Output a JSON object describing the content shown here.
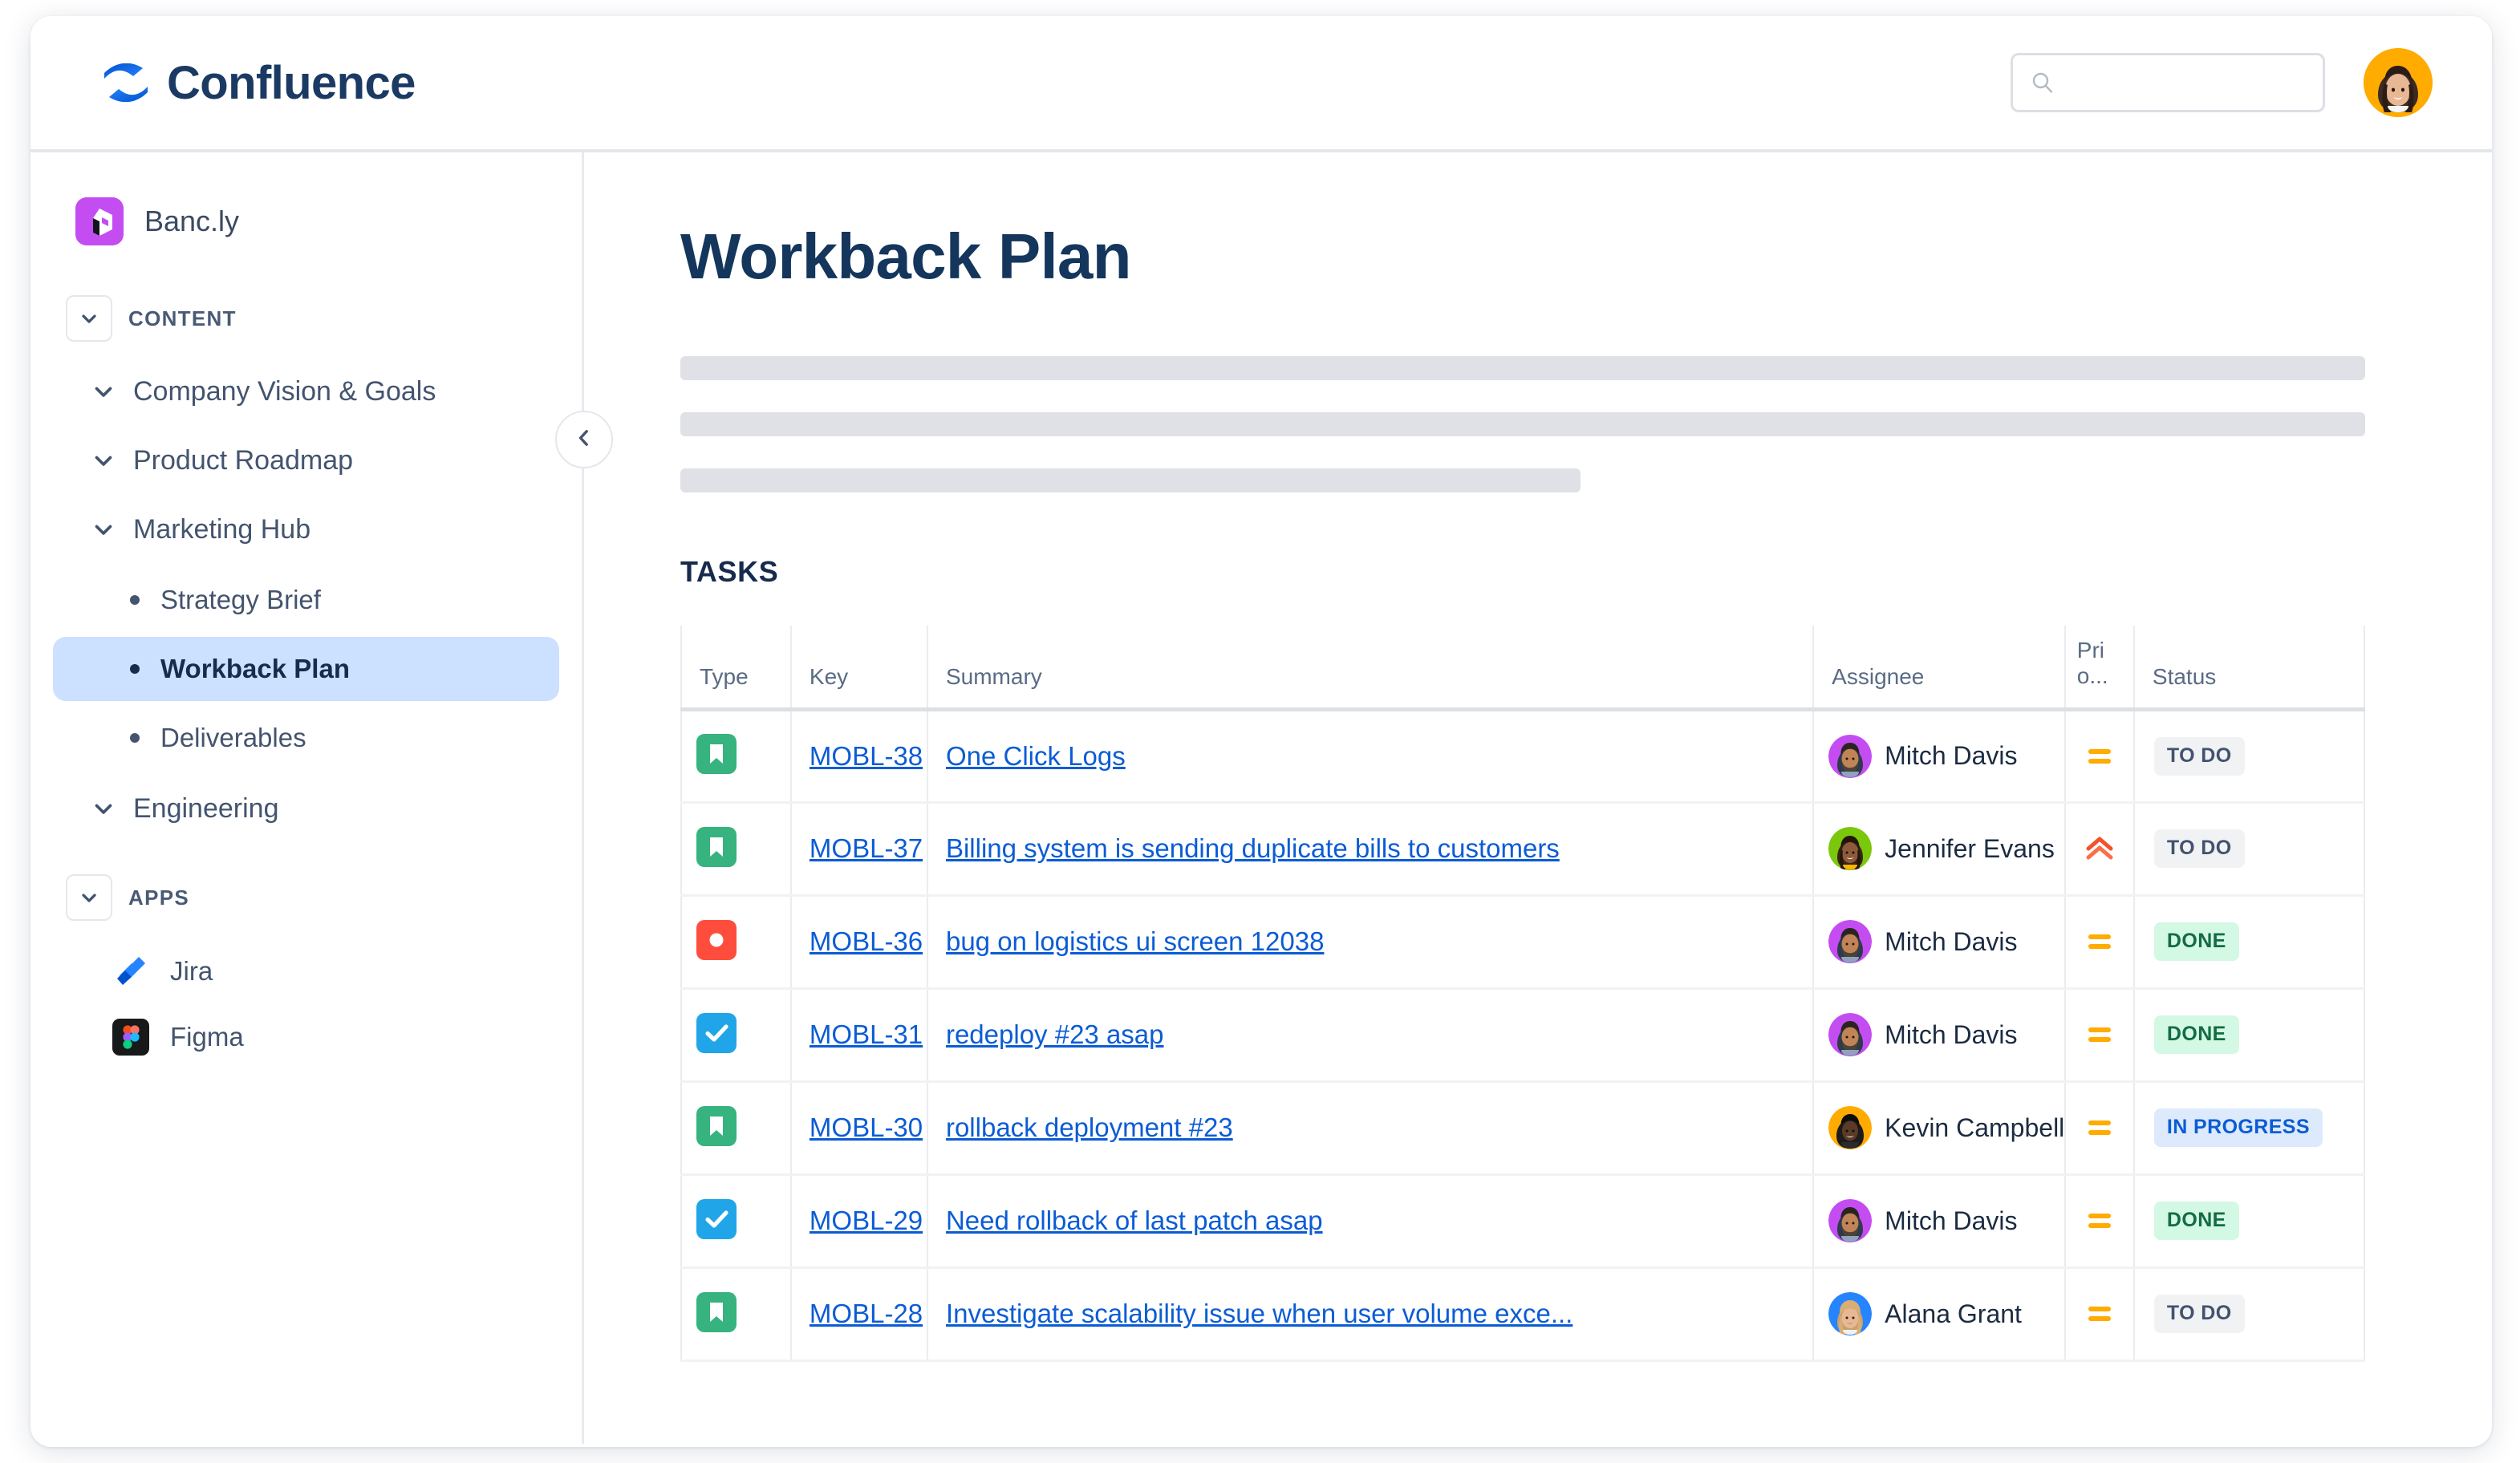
{
  "app": {
    "name": "Confluence",
    "logo_icon": "confluence-logo-icon"
  },
  "topbar": {
    "search": {
      "placeholder": "",
      "value": "",
      "icon": "search-icon"
    },
    "user_avatar": {
      "icon": "user-avatar",
      "background": "#ffab00"
    }
  },
  "sidebar": {
    "space": {
      "name": "Banc.ly",
      "logo_icon": "bancly-logo-icon",
      "logo_color": "#c44df2"
    },
    "collapse_button": {
      "icon": "chevron-left-icon"
    },
    "sections": [
      {
        "label": "CONTENT",
        "chevron_icon": "chevron-down-icon",
        "items": [
          {
            "label": "Company Vision & Goals",
            "chevron_icon": "chevron-down-icon",
            "children": []
          },
          {
            "label": "Product Roadmap",
            "chevron_icon": "chevron-down-icon",
            "children": []
          },
          {
            "label": "Marketing Hub",
            "chevron_icon": "chevron-down-icon",
            "children": [
              {
                "label": "Strategy Brief",
                "selected": false
              },
              {
                "label": "Workback Plan",
                "selected": true
              },
              {
                "label": "Deliverables",
                "selected": false
              }
            ]
          },
          {
            "label": "Engineering",
            "chevron_icon": "chevron-down-icon",
            "children": []
          }
        ]
      },
      {
        "label": "APPS",
        "chevron_icon": "chevron-down-icon",
        "apps": [
          {
            "label": "Jira",
            "icon": "jira-icon"
          },
          {
            "label": "Figma",
            "icon": "figma-icon"
          }
        ]
      }
    ]
  },
  "main": {
    "page_title": "Workback Plan",
    "skeleton_bars": [
      100,
      100,
      53
    ],
    "tasks_heading": "TASKS",
    "table": {
      "columns": [
        {
          "key": "type",
          "label": "Type"
        },
        {
          "key": "key",
          "label": "Key"
        },
        {
          "key": "summary",
          "label": "Summary"
        },
        {
          "key": "assignee",
          "label": "Assignee"
        },
        {
          "key": "priority",
          "label_line1": "Pri",
          "label_line2": "o..."
        },
        {
          "key": "status",
          "label": "Status"
        }
      ],
      "rows": [
        {
          "type": "story",
          "type_icon": "story-icon",
          "type_color": "#36b37e",
          "key": "MOBL-38",
          "summary": "One Click Logs",
          "assignee": "Mitch Davis",
          "assignee_color": "#c44df2",
          "priority": "medium",
          "priority_icon": "priority-medium-icon",
          "status": "TO DO",
          "status_style": "todo"
        },
        {
          "type": "story",
          "type_icon": "story-icon",
          "type_color": "#36b37e",
          "key": "MOBL-37",
          "summary": "Billing system is sending duplicate bills to customers",
          "assignee": "Jennifer Evans",
          "assignee_color": "#7ac70c",
          "priority": "high",
          "priority_icon": "priority-high-icon",
          "status": "TO DO",
          "status_style": "todo"
        },
        {
          "type": "bug",
          "type_icon": "bug-icon",
          "type_color": "#ff4d3d",
          "key": "MOBL-36",
          "summary": "bug on logistics ui screen 12038",
          "assignee": "Mitch Davis",
          "assignee_color": "#c44df2",
          "priority": "medium",
          "priority_icon": "priority-medium-icon",
          "status": "DONE",
          "status_style": "done"
        },
        {
          "type": "task",
          "type_icon": "task-icon",
          "type_color": "#20a6e8",
          "key": "MOBL-31",
          "summary": "redeploy #23 asap",
          "assignee": "Mitch Davis",
          "assignee_color": "#c44df2",
          "priority": "medium",
          "priority_icon": "priority-medium-icon",
          "status": "DONE",
          "status_style": "done"
        },
        {
          "type": "story",
          "type_icon": "story-icon",
          "type_color": "#36b37e",
          "key": "MOBL-30",
          "summary": "rollback deployment #23",
          "assignee": "Kevin Campbell",
          "assignee_color": "#ffab00",
          "priority": "medium",
          "priority_icon": "priority-medium-icon",
          "status": "IN PROGRESS",
          "status_style": "inprogress"
        },
        {
          "type": "task",
          "type_icon": "task-icon",
          "type_color": "#20a6e8",
          "key": "MOBL-29",
          "summary": "Need rollback of last patch asap",
          "assignee": "Mitch Davis",
          "assignee_color": "#c44df2",
          "priority": "medium",
          "priority_icon": "priority-medium-icon",
          "status": "DONE",
          "status_style": "done"
        },
        {
          "type": "story",
          "type_icon": "story-icon",
          "type_color": "#36b37e",
          "key": "MOBL-28",
          "summary": "Investigate scalability issue when user volume exce...",
          "assignee": "Alana Grant",
          "assignee_color": "#2684ff",
          "priority": "medium",
          "priority_icon": "priority-medium-icon",
          "status": "TO DO",
          "status_style": "todo"
        }
      ]
    }
  },
  "colors": {
    "link": "#0b5cd5",
    "title": "#14365c",
    "selected_nav": "#cce0ff",
    "skeleton": "#dfe1e6"
  }
}
